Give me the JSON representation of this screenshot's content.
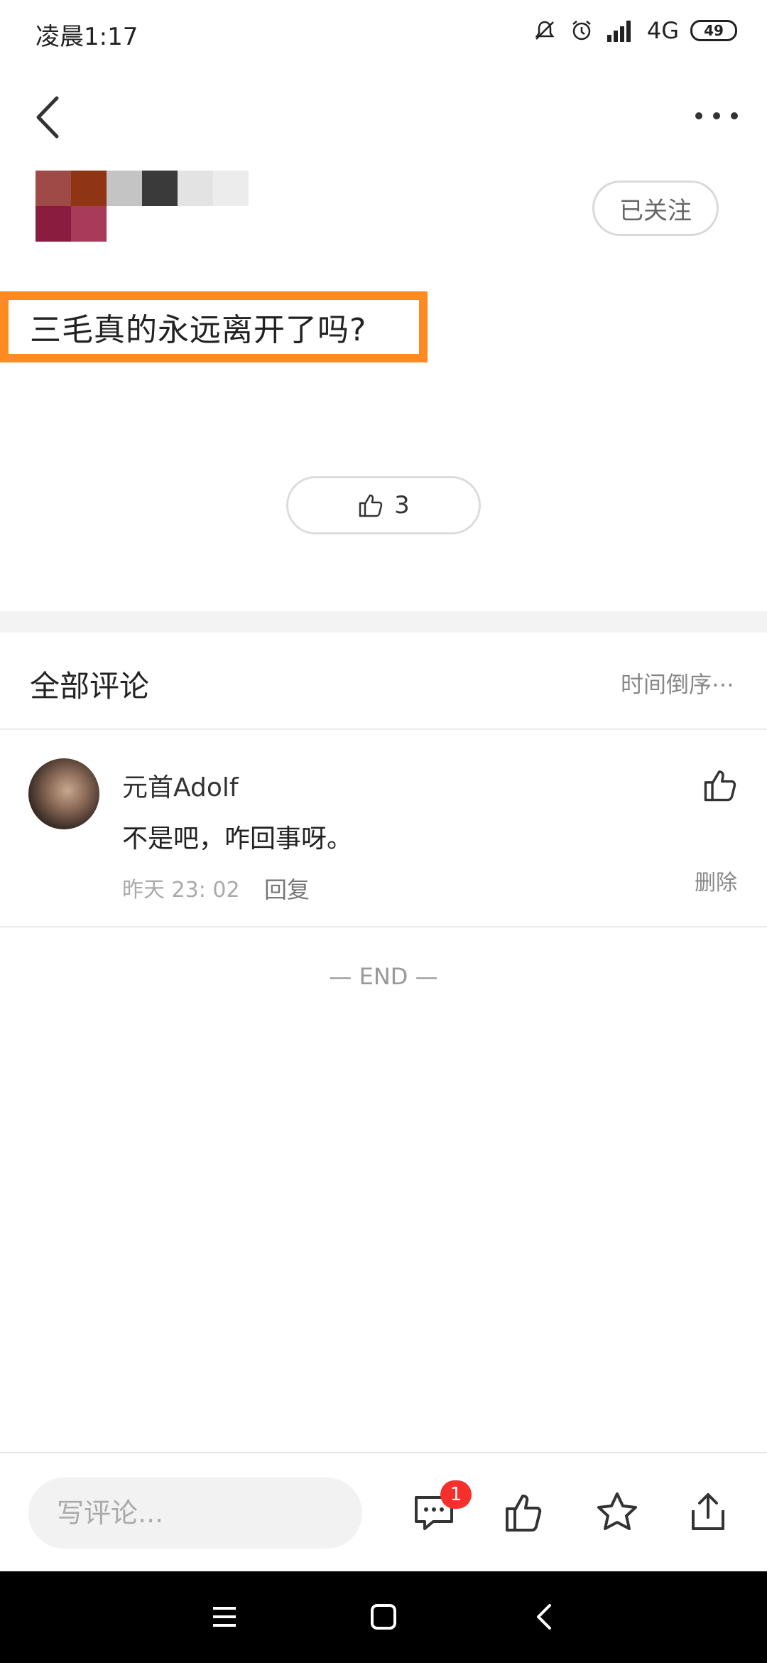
{
  "status_bar": {
    "time": "凌晨1:17",
    "network": "4G",
    "battery": "49"
  },
  "post": {
    "title": "三毛真的永远离开了吗?",
    "like_count": "3",
    "follow_label": "已关注"
  },
  "comments_section": {
    "title": "全部评论",
    "sort_label": "时间倒序⋯"
  },
  "comment": {
    "user": "元首Adolf",
    "text": "不是吧，咋回事呀。",
    "time": "昨天 23: 02",
    "reply_label": "回复",
    "delete_label": "删除"
  },
  "end_label": "— END —",
  "bottom_bar": {
    "input_placeholder": "写评论...",
    "comment_badge": "1"
  },
  "colors": {
    "highlight": "#ff8a1f",
    "badge": "#f5302c",
    "mosaic": [
      "#a04a47",
      "#8f3513",
      "#c4c4c4",
      "#3a3a3a",
      "#e3e3e3",
      "#ececec",
      "#8a1d3f",
      "#a83a5a"
    ]
  }
}
